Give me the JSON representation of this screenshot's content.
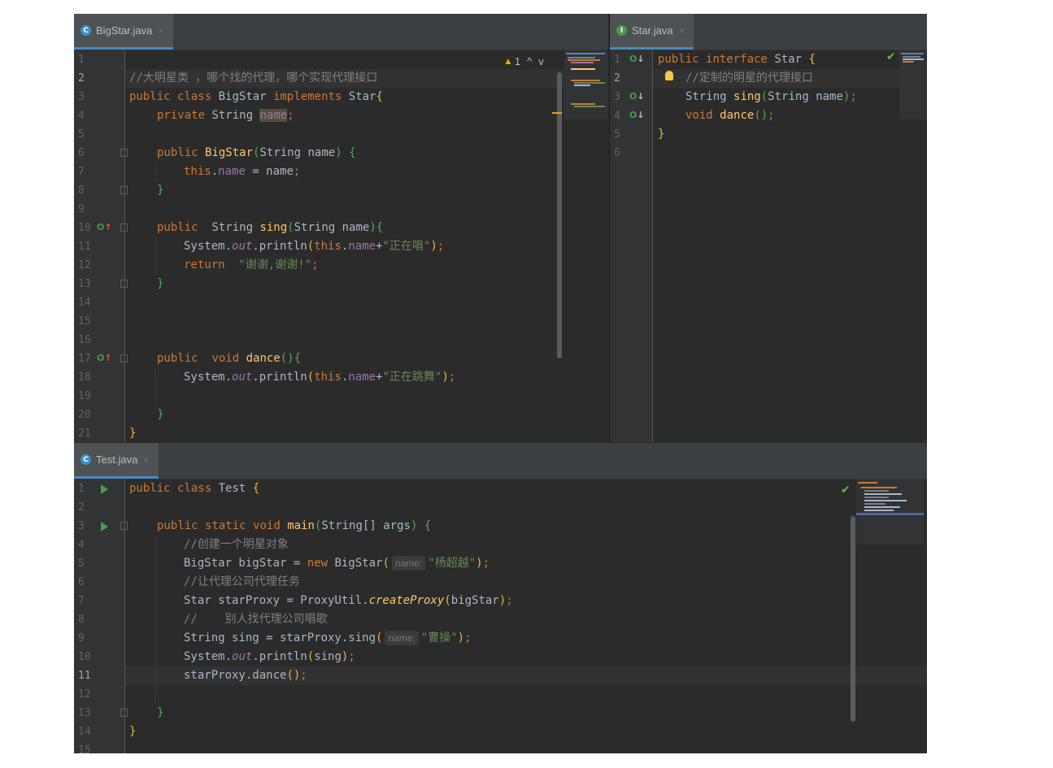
{
  "tabs": {
    "bigstar": {
      "label": "BigStar.java",
      "close": "×"
    },
    "star": {
      "label": "Star.java",
      "close": "×"
    },
    "test": {
      "label": "Test.java",
      "close": "×"
    }
  },
  "inspection": {
    "warning_count": "1",
    "warning_icon": "warning-triangle-icon",
    "up": "^",
    "down": "v"
  },
  "icon_letters": {
    "class": "C",
    "interface": "I"
  },
  "bigstar": {
    "line_numbers": [
      "1",
      "2",
      "3",
      "4",
      "5",
      "6",
      "7",
      "8",
      "9",
      "10",
      "11",
      "12",
      "13",
      "14",
      "15",
      "16",
      "17",
      "18",
      "19",
      "20",
      "21"
    ],
    "l2_comment": "//大明星类 ，哪个找的代理，哪个实现代理接口",
    "l3": {
      "public": "public",
      "class": "class",
      "name": "BigStar",
      "implements": "implements",
      "iface": "Star",
      "brace": "{"
    },
    "l4": {
      "private": "private",
      "type": "String",
      "field": "name",
      "semi": ";"
    },
    "l6": {
      "public": "public",
      "ctor": "BigStar",
      "open": "(",
      "type": "String",
      "param": "name",
      "close": ")",
      "brace": "{"
    },
    "l7": {
      "this": "this",
      "dot": ".",
      "field": "name",
      "rest": " = name",
      "semi": ";"
    },
    "l8": {
      "brace": "}"
    },
    "l10": {
      "public": "public",
      "type": "String",
      "method": "sing",
      "open": "(",
      "ptype": "String",
      "param": "name",
      "close": ")",
      "brace": "{"
    },
    "l11": {
      "sys": "System.",
      "out": "out",
      "call": ".println",
      "open": "(",
      "this": "this",
      "dot": ".",
      "field": "name",
      "plus": "+",
      "str": "\"正在唱\"",
      "close": ")",
      "semi": ";"
    },
    "l12": {
      "return": "return",
      "str": "\"谢谢,谢谢!\"",
      "semi": ";"
    },
    "l13": {
      "brace": "}"
    },
    "l17": {
      "public": "public",
      "void": "void",
      "method": "dance",
      "parens": "()",
      "brace": "{"
    },
    "l18": {
      "sys": "System.",
      "out": "out",
      "call": ".println",
      "open": "(",
      "this": "this",
      "dot": ".",
      "field": "name",
      "plus": "+",
      "str": "\"正在跳舞\"",
      "close": ")",
      "semi": ";"
    },
    "l20": {
      "brace": "}"
    },
    "l21": {
      "brace": "}"
    }
  },
  "star": {
    "line_numbers": [
      "1",
      "2",
      "3",
      "4",
      "5",
      "6"
    ],
    "l1": {
      "public": "public",
      "interface": "interface",
      "name": "Star",
      "brace": "{"
    },
    "l2_comment": "//定制的明星的代理接口",
    "l3": {
      "type": "String",
      "method": "sing",
      "open": "(",
      "ptype": "String",
      "param": "name",
      "close": ")",
      "semi": ";"
    },
    "l4": {
      "void": "void",
      "method": "dance",
      "parens": "()",
      "semi": ";"
    },
    "l5": {
      "brace": "}"
    }
  },
  "test": {
    "line_numbers": [
      "1",
      "2",
      "3",
      "4",
      "5",
      "6",
      "7",
      "8",
      "9",
      "10",
      "11",
      "12",
      "13",
      "14",
      "15"
    ],
    "l1": {
      "public": "public",
      "class": "class",
      "name": "Test",
      "brace": "{"
    },
    "l3": {
      "public": "public",
      "static": "static",
      "void": "void",
      "method": "main",
      "open": "(",
      "type": "String[]",
      "param": "args",
      "close": ")",
      "brace": "{"
    },
    "l4_comment": "//创建一个明星对象",
    "l5": {
      "decl": "BigStar bigStar = ",
      "new": "new",
      "ctor": "BigStar",
      "open": "(",
      "hint": "name:",
      "str": "\"杨超越\"",
      "close": ")",
      "semi": ";"
    },
    "l6_comment": "//让代理公司代理任务",
    "l7": {
      "decl": "Star starProxy = ProxyUtil.",
      "call": "createProxy",
      "open": "(",
      "arg": "bigStar",
      "close": ")",
      "semi": ";"
    },
    "l8_comment": "//    别人找代理公司唱歌",
    "l9": {
      "decl": "String sing = starProxy.sing",
      "open": "(",
      "hint": "name:",
      "str": "\"曹操\"",
      "close": ")",
      "semi": ";"
    },
    "l10": {
      "sys": "System.",
      "out": "out",
      "call": ".println",
      "open": "(",
      "arg": "sing",
      "close": ")",
      "semi": ";"
    },
    "l11": {
      "expr": "starProxy.dance",
      "parens": "()",
      "semi": ";"
    },
    "l13": {
      "brace": "}"
    },
    "l14": {
      "brace": "}"
    }
  },
  "colors": {
    "keyword": "#cc7832",
    "method": "#ffc66d",
    "string": "#6a8759",
    "comment": "#808080",
    "field": "#9876aa",
    "brace": "#e8ba36",
    "tab_underline": "#4a88c7",
    "class_icon": "#3a94c5",
    "interface_icon": "#4a9a4a"
  }
}
